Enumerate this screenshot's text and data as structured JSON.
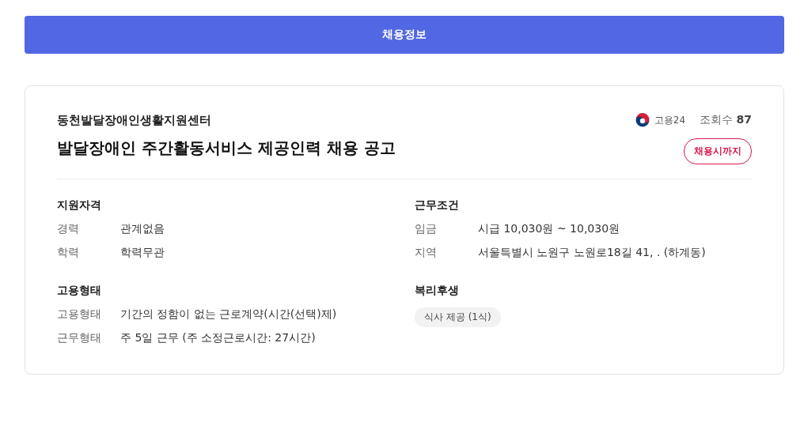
{
  "header_bar": {
    "title": "채용정보"
  },
  "posting": {
    "company": "동천발달장애인생활지원센터",
    "title": "발달장애인 주간활동서비스 제공인력 채용 공고",
    "source": "고용24",
    "views_label": "조회수",
    "views": "87",
    "deadline_badge": "채용시까지"
  },
  "sections": [
    {
      "kind": "rows",
      "title": "지원자격",
      "rows": [
        {
          "label": "경력",
          "value": "관계없음"
        },
        {
          "label": "학력",
          "value": "학력무관"
        }
      ]
    },
    {
      "kind": "rows",
      "title": "근무조건",
      "rows": [
        {
          "label": "임금",
          "value": "시급 10,030원 ~ 10,030원"
        },
        {
          "label": "지역",
          "value": "서울특별시 노원구 노원로18길 41, . (하계동)"
        }
      ]
    },
    {
      "kind": "rows",
      "title": "고용형태",
      "rows": [
        {
          "label": "고용형태",
          "value": "기간의 정함이 없는 근로계약(시간(선택)제)"
        },
        {
          "label": "근무형태",
          "value": "주 5일 근무 (주 소정근로시간: 27시간)"
        }
      ]
    },
    {
      "kind": "tags",
      "title": "복리후생",
      "tags": [
        "식사 제공 (1식)"
      ]
    }
  ]
}
